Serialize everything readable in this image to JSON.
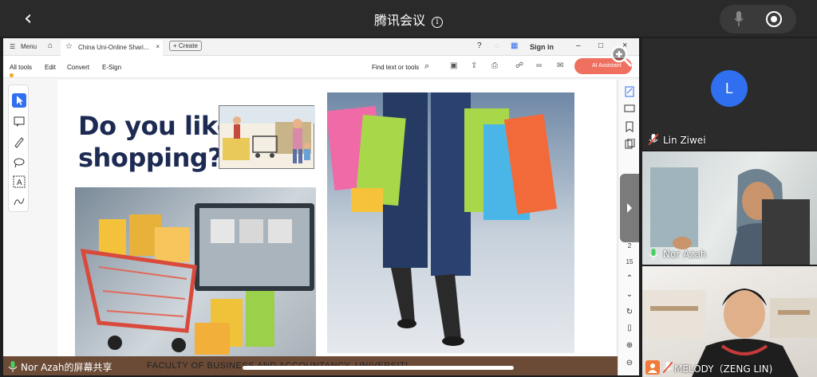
{
  "meeting": {
    "back_glyph": "‹",
    "title": "腾讯会议",
    "info_glyph": "i"
  },
  "top_controls": {
    "mic_icon": "mic-icon",
    "record_icon": "record-icon"
  },
  "browser": {
    "menu_label": "Menu",
    "tab_title": "China Uni-Online Shari...",
    "tab_close": "×",
    "create_label": "Create",
    "sign_in": "Sign in",
    "win_min": "–",
    "win_max": "□",
    "win_close": "×"
  },
  "acrobat_toolbar": {
    "all_tools": "All tools",
    "edit": "Edit",
    "convert": "Convert",
    "esign": "E-Sign",
    "find": "Find text or tools",
    "ai_assistant": "AI Assistant"
  },
  "slide": {
    "headline_line1": "Do you like",
    "headline_line2": "shopping?",
    "footer": "FACULTY OF BUSINESS AND ACCOUNTANCY, UNIVERSITI ..."
  },
  "page_nav": {
    "current": "2",
    "total": "15"
  },
  "share_label": "Nor Azah的屏幕共享",
  "participants": [
    {
      "name": "Lin Ziwei",
      "avatar_letter": "L",
      "mic": "muted"
    },
    {
      "name": "Nor Azah",
      "mic": "active"
    },
    {
      "name": "MELODY（ZENG LIN)",
      "mic": "muted"
    }
  ],
  "colors": {
    "accent_blue": "#2f6ff0",
    "mic_green": "#4ad060",
    "muted_red": "#e84a3c",
    "ai_orange": "#f07060"
  }
}
